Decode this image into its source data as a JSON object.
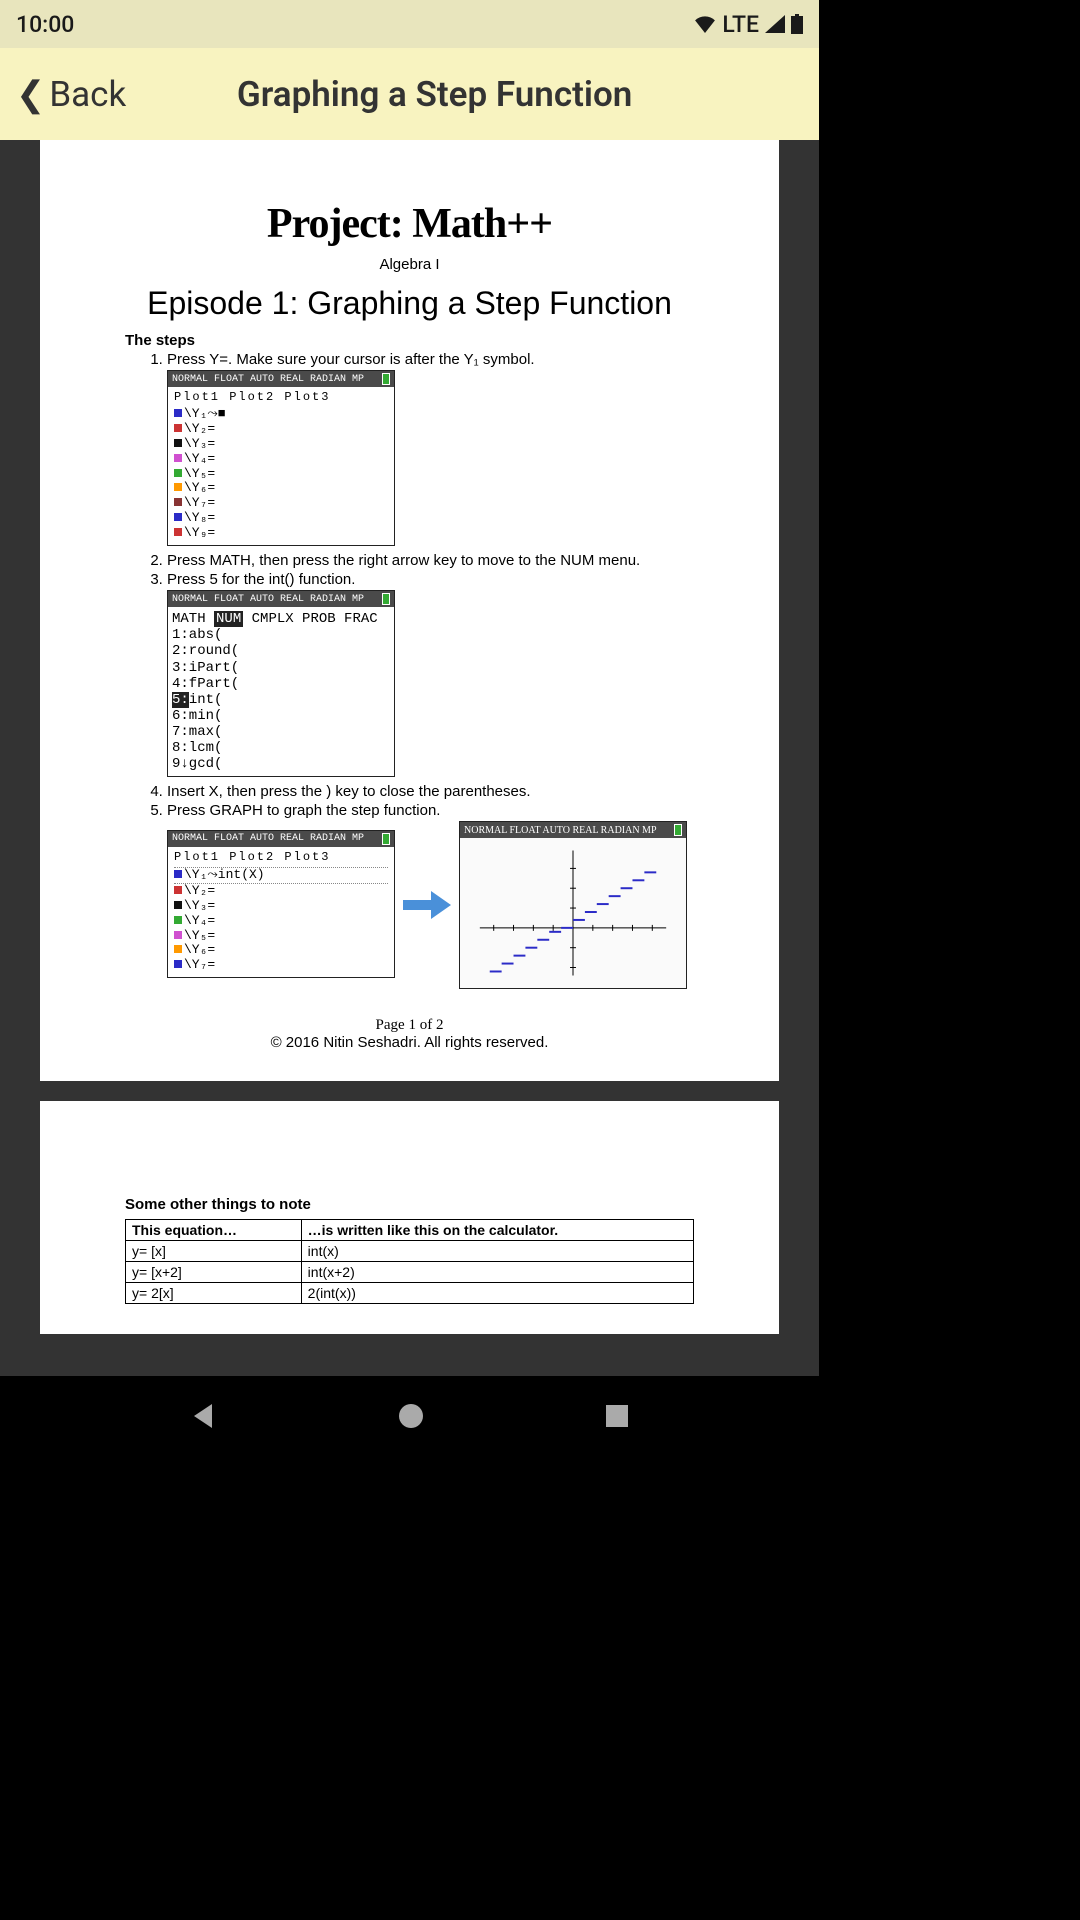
{
  "status": {
    "time": "10:00",
    "net": "LTE"
  },
  "header": {
    "back": "Back",
    "title": "Graphing a Step Function"
  },
  "doc": {
    "project_title": "Project: Math++",
    "subject": "Algebra I",
    "episode": "Episode 1: Graphing a Step Function",
    "steps_header": "The steps",
    "steps": [
      "Press Y=. Make sure your cursor is after the Y₁ symbol.",
      "Press MATH, then press the right arrow key to move to the NUM menu.",
      "Press 5 for the int() function.",
      "Insert X, then press the ) key to close the parentheses.",
      "Press GRAPH to graph the step function."
    ],
    "calc_header": "NORMAL FLOAT AUTO REAL RADIAN MP",
    "calc1": {
      "plots": "Plot1   Plot2   Plot3",
      "ylines": [
        {
          "c": "#2b2bc7",
          "t": "\\Y₁⤳■"
        },
        {
          "c": "#c33",
          "t": "\\Y₂="
        },
        {
          "c": "#111",
          "t": "\\Y₃="
        },
        {
          "c": "#d050d0",
          "t": "\\Y₄="
        },
        {
          "c": "#3a3",
          "t": "\\Y₅="
        },
        {
          "c": "#f90",
          "t": "\\Y₆="
        },
        {
          "c": "#833",
          "t": "\\Y₇="
        },
        {
          "c": "#2b2bc7",
          "t": "\\Y₈="
        },
        {
          "c": "#c33",
          "t": "\\Y₉="
        }
      ]
    },
    "calc2": {
      "hdr": "MATH NUM CMPLX PROB FRAC",
      "items": [
        "1:abs(",
        "2:round(",
        "3:iPart(",
        "4:fPart(",
        "5:int(",
        "6:min(",
        "7:max(",
        "8:lcm(",
        "9↓gcd("
      ]
    },
    "calc3": {
      "plots": "Plot1   Plot2   Plot3",
      "formula": "\\Y₁⤳int(X)",
      "rest": [
        {
          "c": "#c33",
          "t": "\\Y₂="
        },
        {
          "c": "#111",
          "t": "\\Y₃="
        },
        {
          "c": "#3a3",
          "t": "\\Y₄="
        },
        {
          "c": "#d050d0",
          "t": "\\Y₅="
        },
        {
          "c": "#f90",
          "t": "\\Y₆="
        },
        {
          "c": "#2b2bc7",
          "t": "\\Y₇="
        }
      ]
    },
    "page_number": "Page 1 of 2",
    "copyright": "© 2016 Nitin Seshadri. All rights reserved.",
    "notes_header": "Some other things to note",
    "table": {
      "h1": "This equation…",
      "h2": "…is written like this on the calculator.",
      "rows": [
        [
          "y= [x]",
          "int(x)"
        ],
        [
          "y= [x+2]",
          "int(x+2)"
        ],
        [
          "y= 2[x]",
          "2(int(x))"
        ]
      ]
    }
  }
}
